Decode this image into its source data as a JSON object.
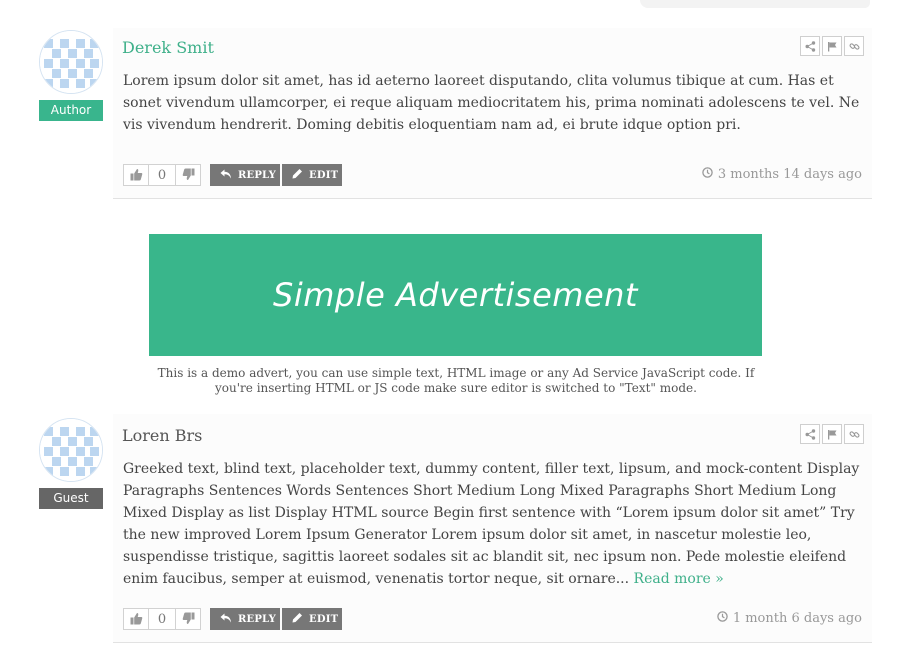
{
  "comments": [
    {
      "author": "Derek Smit",
      "role": "Author",
      "text": "Lorem ipsum dolor sit amet, has id aeterno laoreet disputando, clita volumus tibique at cum. Has et sonet vivendum ullamcorper, ei reque aliquam mediocritatem his, prima nominati adolescens te vel. Ne vis vivendum hendrerit. Doming debitis eloquentiam nam ad, ei brute idque option pri.",
      "votes": "0",
      "reply_label": "REPLY",
      "edit_label": "EDIT",
      "timestamp": "3 months 14 days ago"
    },
    {
      "author": "Loren Brs",
      "role": "Guest",
      "text": "Greeked text, blind text, placeholder text, dummy content, filler text, lipsum, and mock-content Display Paragraphs Sentences Words Sentences Short Medium Long Mixed Paragraphs Short Medium Long Mixed Display as list Display HTML source Begin first sentence with “Lorem ipsum dolor sit amet” Try the new improved Lorem Ipsum Generator Lorem ipsum dolor sit amet, in nascetur molestie leo, suspendisse tristique, sagittis laoreet sodales sit ac blandit sit, nec ipsum non. Pede molestie eleifend enim faucibus, semper at euismod, venenatis tortor neque, sit ornare...",
      "read_more": "Read more »",
      "votes": "0",
      "reply_label": "REPLY",
      "edit_label": "EDIT",
      "timestamp": "1 month 6 days ago"
    }
  ],
  "ad": {
    "title": "Simple Advertisement",
    "note": "This is a demo advert, you can use simple text, HTML image or any Ad Service JavaScript code. If you're inserting HTML or JS code make sure editor is switched to \"Text\" mode."
  },
  "colors": {
    "accent": "#39b58d",
    "guest_badge": "#666666",
    "button": "#777777"
  },
  "icons": [
    "share-icon",
    "flag-icon",
    "link-icon",
    "thumbs-up-icon",
    "thumbs-down-icon",
    "reply-icon",
    "pencil-icon",
    "clock-icon"
  ]
}
